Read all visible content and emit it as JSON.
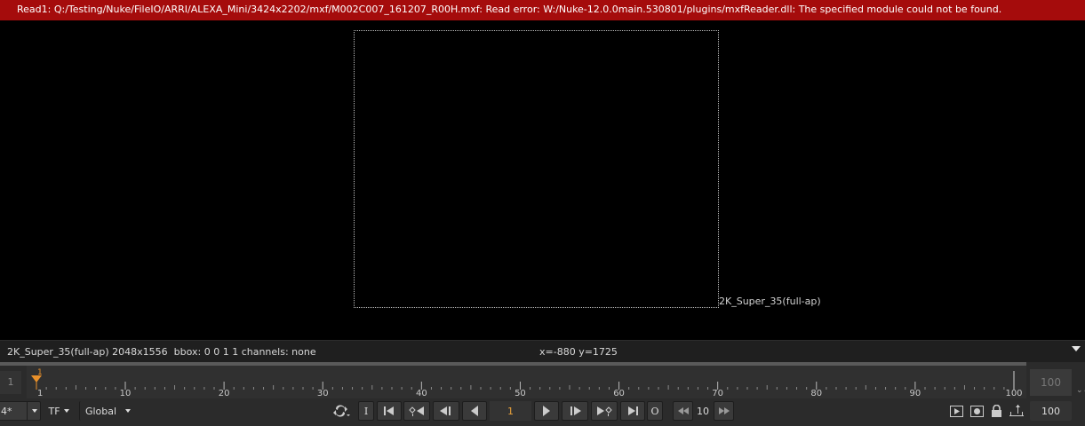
{
  "error": {
    "message": "Read1: Q:/Testing/Nuke/FileIO/ARRI/ALEXA_Mini/3424x2202/mxf/M002C007_161207_R00H.mxf: Read error: W:/Nuke-12.0.0main.530801/plugins/mxfReader.dll: The specified module could not be found."
  },
  "viewer": {
    "format_label": "2K_Super_35(full-ap)"
  },
  "info_bar": {
    "format_info": "2K_Super_35(full-ap) 2048x1556  bbox: 0 0 1 1 channels: none",
    "coords": "x=-880 y=1725"
  },
  "timeline": {
    "in_frame": "1",
    "out_frame": "100",
    "current_frame_marker": "1",
    "frame_start": 1,
    "frame_end": 100,
    "tick_labels": [
      "1",
      "10",
      "20",
      "30",
      "40",
      "50",
      "60",
      "70",
      "80",
      "90",
      "100"
    ],
    "scroll_arrows": "⌄⌄",
    "marker_color": "#e8902a"
  },
  "controls": {
    "fps_value": "4*",
    "tf_label": "TF",
    "global_label": "Global",
    "frame_value": "1",
    "step_value": "10",
    "end_frame_value": "100",
    "in_point_label": "I",
    "out_point_label": "O"
  },
  "colors": {
    "error_bg": "#a50c0c",
    "viewer_bg": "#000000",
    "panel_bg": "#2b2b2b",
    "accent_orange": "#e8a13a"
  }
}
